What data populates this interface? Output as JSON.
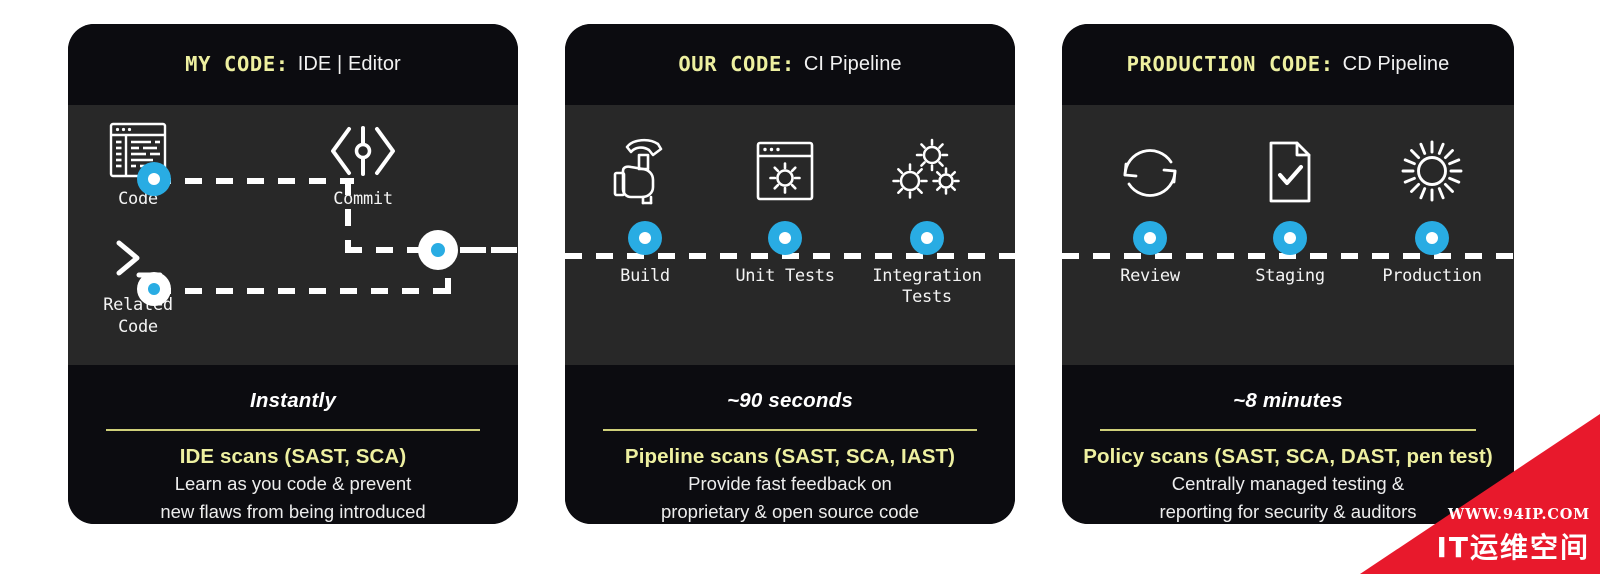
{
  "panels": [
    {
      "id": "my-code",
      "header": {
        "strong": "MY CODE:",
        "rest": "IDE | Editor"
      },
      "nodes": [
        {
          "label": "Code",
          "icon": "code-window-icon"
        },
        {
          "label": "Related\nCode",
          "icon": "terminal-prompt-icon"
        },
        {
          "label": "Commit",
          "icon": "git-commit-icon"
        }
      ],
      "timing": "Instantly",
      "scan_title": "IDE scans (SAST, SCA)",
      "scan_desc_line1": "Learn as you code & prevent",
      "scan_desc_line2": "new flaws from being introduced"
    },
    {
      "id": "our-code",
      "header": {
        "strong": "OUR CODE:",
        "rest": "CI Pipeline"
      },
      "stages": [
        {
          "label": "Build",
          "icon": "hammer-icon"
        },
        {
          "label": "Unit Tests",
          "icon": "browser-gear-icon"
        },
        {
          "label": "Integration Tests",
          "icon": "three-gears-icon"
        }
      ],
      "timing": "~90 seconds",
      "scan_title": "Pipeline scans (SAST, SCA, IAST)",
      "scan_desc_line1": "Provide fast feedback on",
      "scan_desc_line2": "proprietary & open source code"
    },
    {
      "id": "production-code",
      "header": {
        "strong": "PRODUCTION CODE:",
        "rest": "CD Pipeline"
      },
      "stages": [
        {
          "label": "Review",
          "icon": "refresh-cycle-icon"
        },
        {
          "label": "Staging",
          "icon": "document-check-icon"
        },
        {
          "label": "Production",
          "icon": "gear-icon"
        }
      ],
      "timing": "~8 minutes",
      "scan_title": "Policy scans (SAST, SCA, DAST, pen test)",
      "scan_desc_line1": "Centrally managed testing &",
      "scan_desc_line2": "reporting for security & auditors"
    }
  ],
  "watermark": {
    "url": "WWW.94IP.COM",
    "name": "IT运维空间"
  },
  "colors": {
    "panel_dark": "#0c0c10",
    "panel_mid": "#282828",
    "accent_yellow": "#eef0a0",
    "divider_yellow": "#cfd07a",
    "node_blue": "#29ace3",
    "text_white": "#f4f4f4",
    "watermark_red": "#e8192c"
  }
}
